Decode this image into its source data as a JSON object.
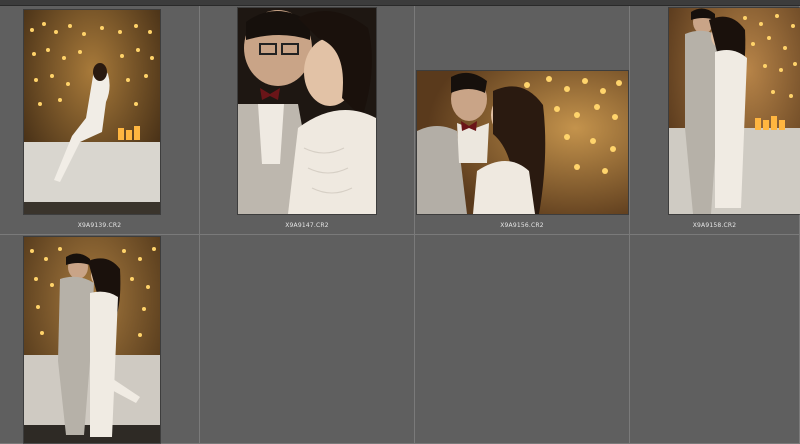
{
  "browser": {
    "items": [
      {
        "filename": "X9A9139.CR2"
      },
      {
        "filename": "X9A9147.CR2"
      },
      {
        "filename": "X9A9156.CR2"
      },
      {
        "filename": "X9A9158.CR2"
      },
      {
        "filename": ""
      }
    ]
  },
  "colors": {
    "background": "#5b5b5b",
    "cell_border": "#7a7a7a",
    "label_text": "#e6e6e6",
    "bulb": "#ffc94a",
    "brick": "#6b4a28"
  }
}
